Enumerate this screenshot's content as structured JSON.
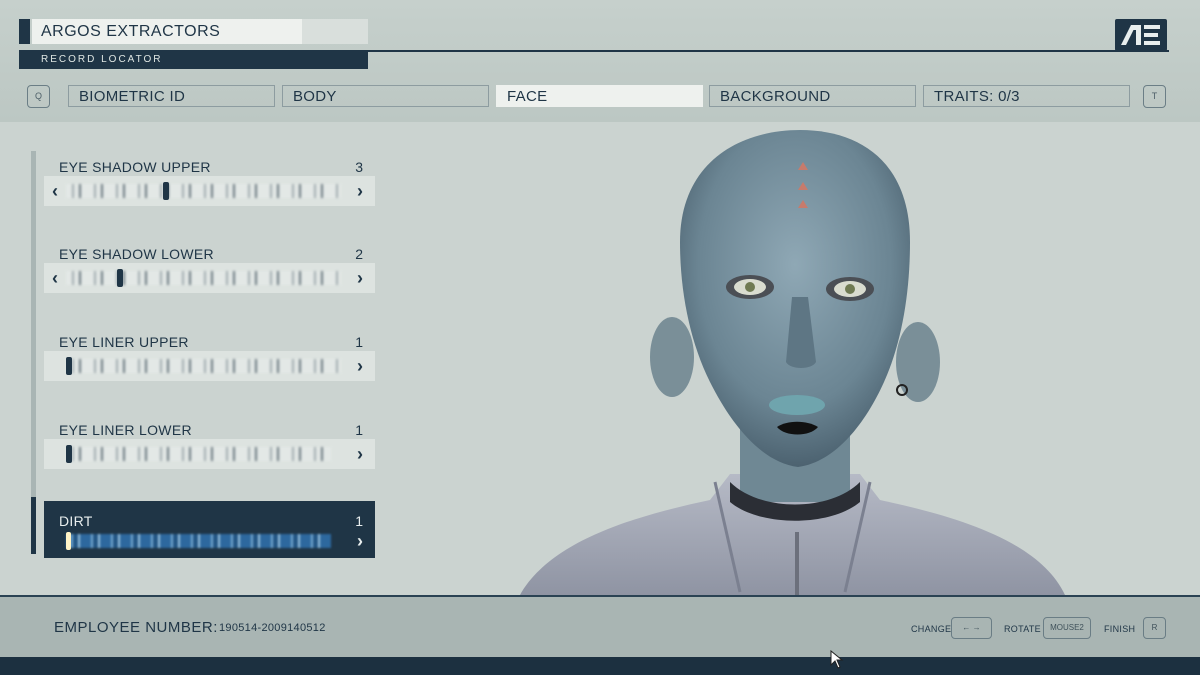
{
  "header": {
    "org_name": "ARGOS EXTRACTORS",
    "record_locator": "RECORD LOCATOR",
    "logo_text": "AE",
    "prev_key": "Q",
    "next_key": "T",
    "tabs": [
      {
        "label": "BIOMETRIC ID",
        "active": false
      },
      {
        "label": "BODY",
        "active": false
      },
      {
        "label": "FACE",
        "active": true
      },
      {
        "label": "BACKGROUND",
        "active": false
      },
      {
        "label": "TRAITS: 0/3",
        "active": false
      }
    ]
  },
  "sliders": [
    {
      "label": "EYE SHADOW UPPER",
      "value": "3",
      "thumb_fraction": 0.36,
      "has_left_arrow": true
    },
    {
      "label": "EYE SHADOW LOWER",
      "value": "2",
      "thumb_fraction": 0.19,
      "has_left_arrow": true
    },
    {
      "label": "EYE LINER UPPER",
      "value": "1",
      "thumb_fraction": 0.0,
      "has_left_arrow": false
    },
    {
      "label": "EYE LINER LOWER",
      "value": "1",
      "thumb_fraction": 0.0,
      "has_left_arrow": false
    },
    {
      "label": "DIRT",
      "value": "1",
      "thumb_fraction": 0.0,
      "has_left_arrow": false,
      "selected": true
    }
  ],
  "footer": {
    "employee_label": "EMPLOYEE NUMBER:",
    "employee_number": "190514-2009140512",
    "hints": [
      {
        "action": "CHANGE",
        "key": "← →"
      },
      {
        "action": "ROTATE",
        "key": "MOUSE2"
      },
      {
        "action": "FINISH",
        "key": "R"
      }
    ]
  },
  "colors": {
    "navy": "#1f3546",
    "panel_bg": "#cbd3d0",
    "active_tab": "#eef1ee",
    "selected_track": "#2f6ea8"
  }
}
